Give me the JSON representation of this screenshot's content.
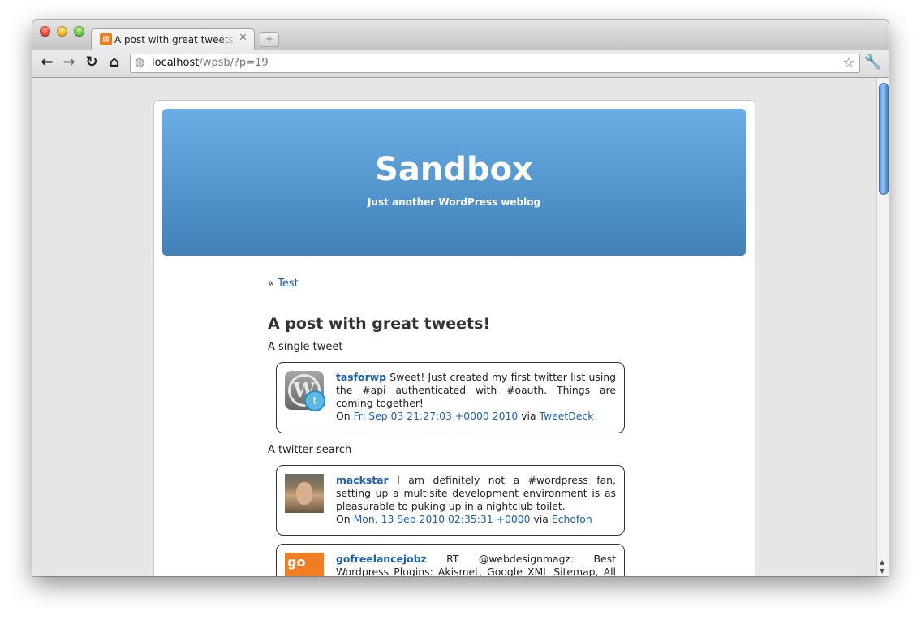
{
  "browser": {
    "tab_title": "A post with great tweets! « Sandbox",
    "tab_close": "✕",
    "new_tab": "+",
    "url_host": "localhost",
    "url_path": "/wpsb/?p=19"
  },
  "site": {
    "title": "Sandbox",
    "description": "Just another WordPress weblog"
  },
  "nav": {
    "prev_arrow": "«",
    "prev_link": "Test"
  },
  "post": {
    "title": "A post with great tweets!",
    "single_label": "A single tweet",
    "search_label": "A twitter search"
  },
  "tweets": [
    {
      "author": "tasforwp",
      "text": "Sweet! Just created my first twitter list using the #api authenticated with #oauth. Things are coming together!",
      "on": "On",
      "date": "Fri Sep 03 21:27:03 +0000 2010",
      "via": "via",
      "source": "TweetDeck",
      "avatar_icon": "wordpress-twitter-avatar"
    },
    {
      "author": "mackstar",
      "text": "I am definitely not a #wordpress fan, setting up a multisite development environment is as pleasurable to puking up in a nightclub toilet.",
      "on": "On",
      "date": "Mon, 13 Sep 2010 02:35:31 +0000",
      "via": "via",
      "source": "Echofon",
      "avatar_icon": "user-photo-avatar"
    },
    {
      "author": "gofreelancejobz",
      "text": "RT @webdesignmagz: Best Wordpress Plugins: Akismet, Google XML Sitemap, All in One",
      "avatar_text": "go",
      "avatar_icon": "go-logo-avatar"
    }
  ],
  "colors": {
    "link": "#1a5fb4",
    "header_top": "#6aaee6",
    "header_bottom": "#4280b8"
  }
}
